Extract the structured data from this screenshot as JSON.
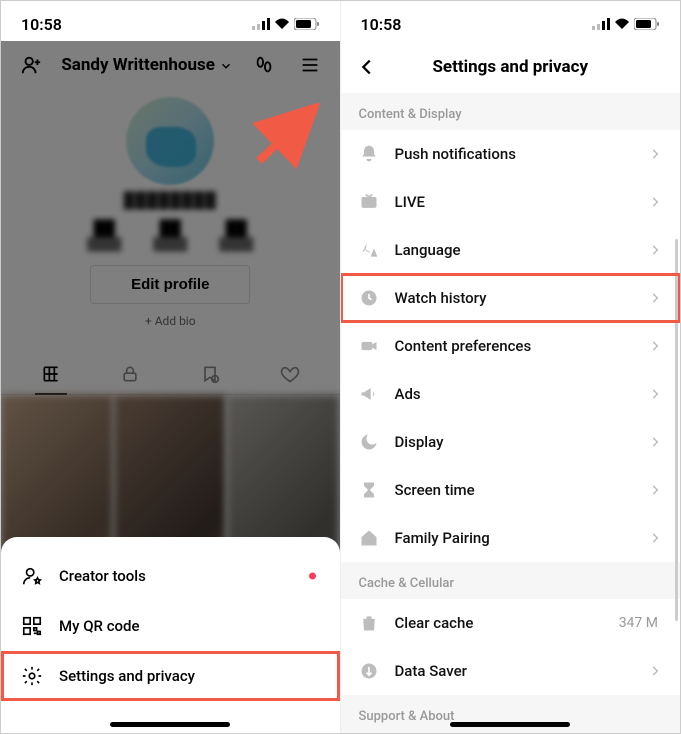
{
  "status": {
    "time": "10:58"
  },
  "left": {
    "profileName": "Sandy Writtenhouse",
    "username": "████████",
    "editProfile": "Edit profile",
    "addBio": "+ Add bio",
    "sheet": {
      "items": [
        {
          "label": "Creator tools",
          "hasDot": true
        },
        {
          "label": "My QR code"
        },
        {
          "label": "Settings and privacy",
          "highlighted": true
        }
      ]
    }
  },
  "right": {
    "title": "Settings and privacy",
    "sections": [
      {
        "label": "Content & Display",
        "rows": [
          {
            "label": "Push notifications"
          },
          {
            "label": "LIVE"
          },
          {
            "label": "Language"
          },
          {
            "label": "Watch history",
            "highlighted": true
          },
          {
            "label": "Content preferences"
          },
          {
            "label": "Ads"
          },
          {
            "label": "Display"
          },
          {
            "label": "Screen time"
          },
          {
            "label": "Family Pairing"
          }
        ]
      },
      {
        "label": "Cache & Cellular",
        "rows": [
          {
            "label": "Clear cache",
            "sub": "347 M"
          },
          {
            "label": "Data Saver"
          }
        ]
      },
      {
        "label": "Support & About",
        "rows": []
      }
    ]
  }
}
